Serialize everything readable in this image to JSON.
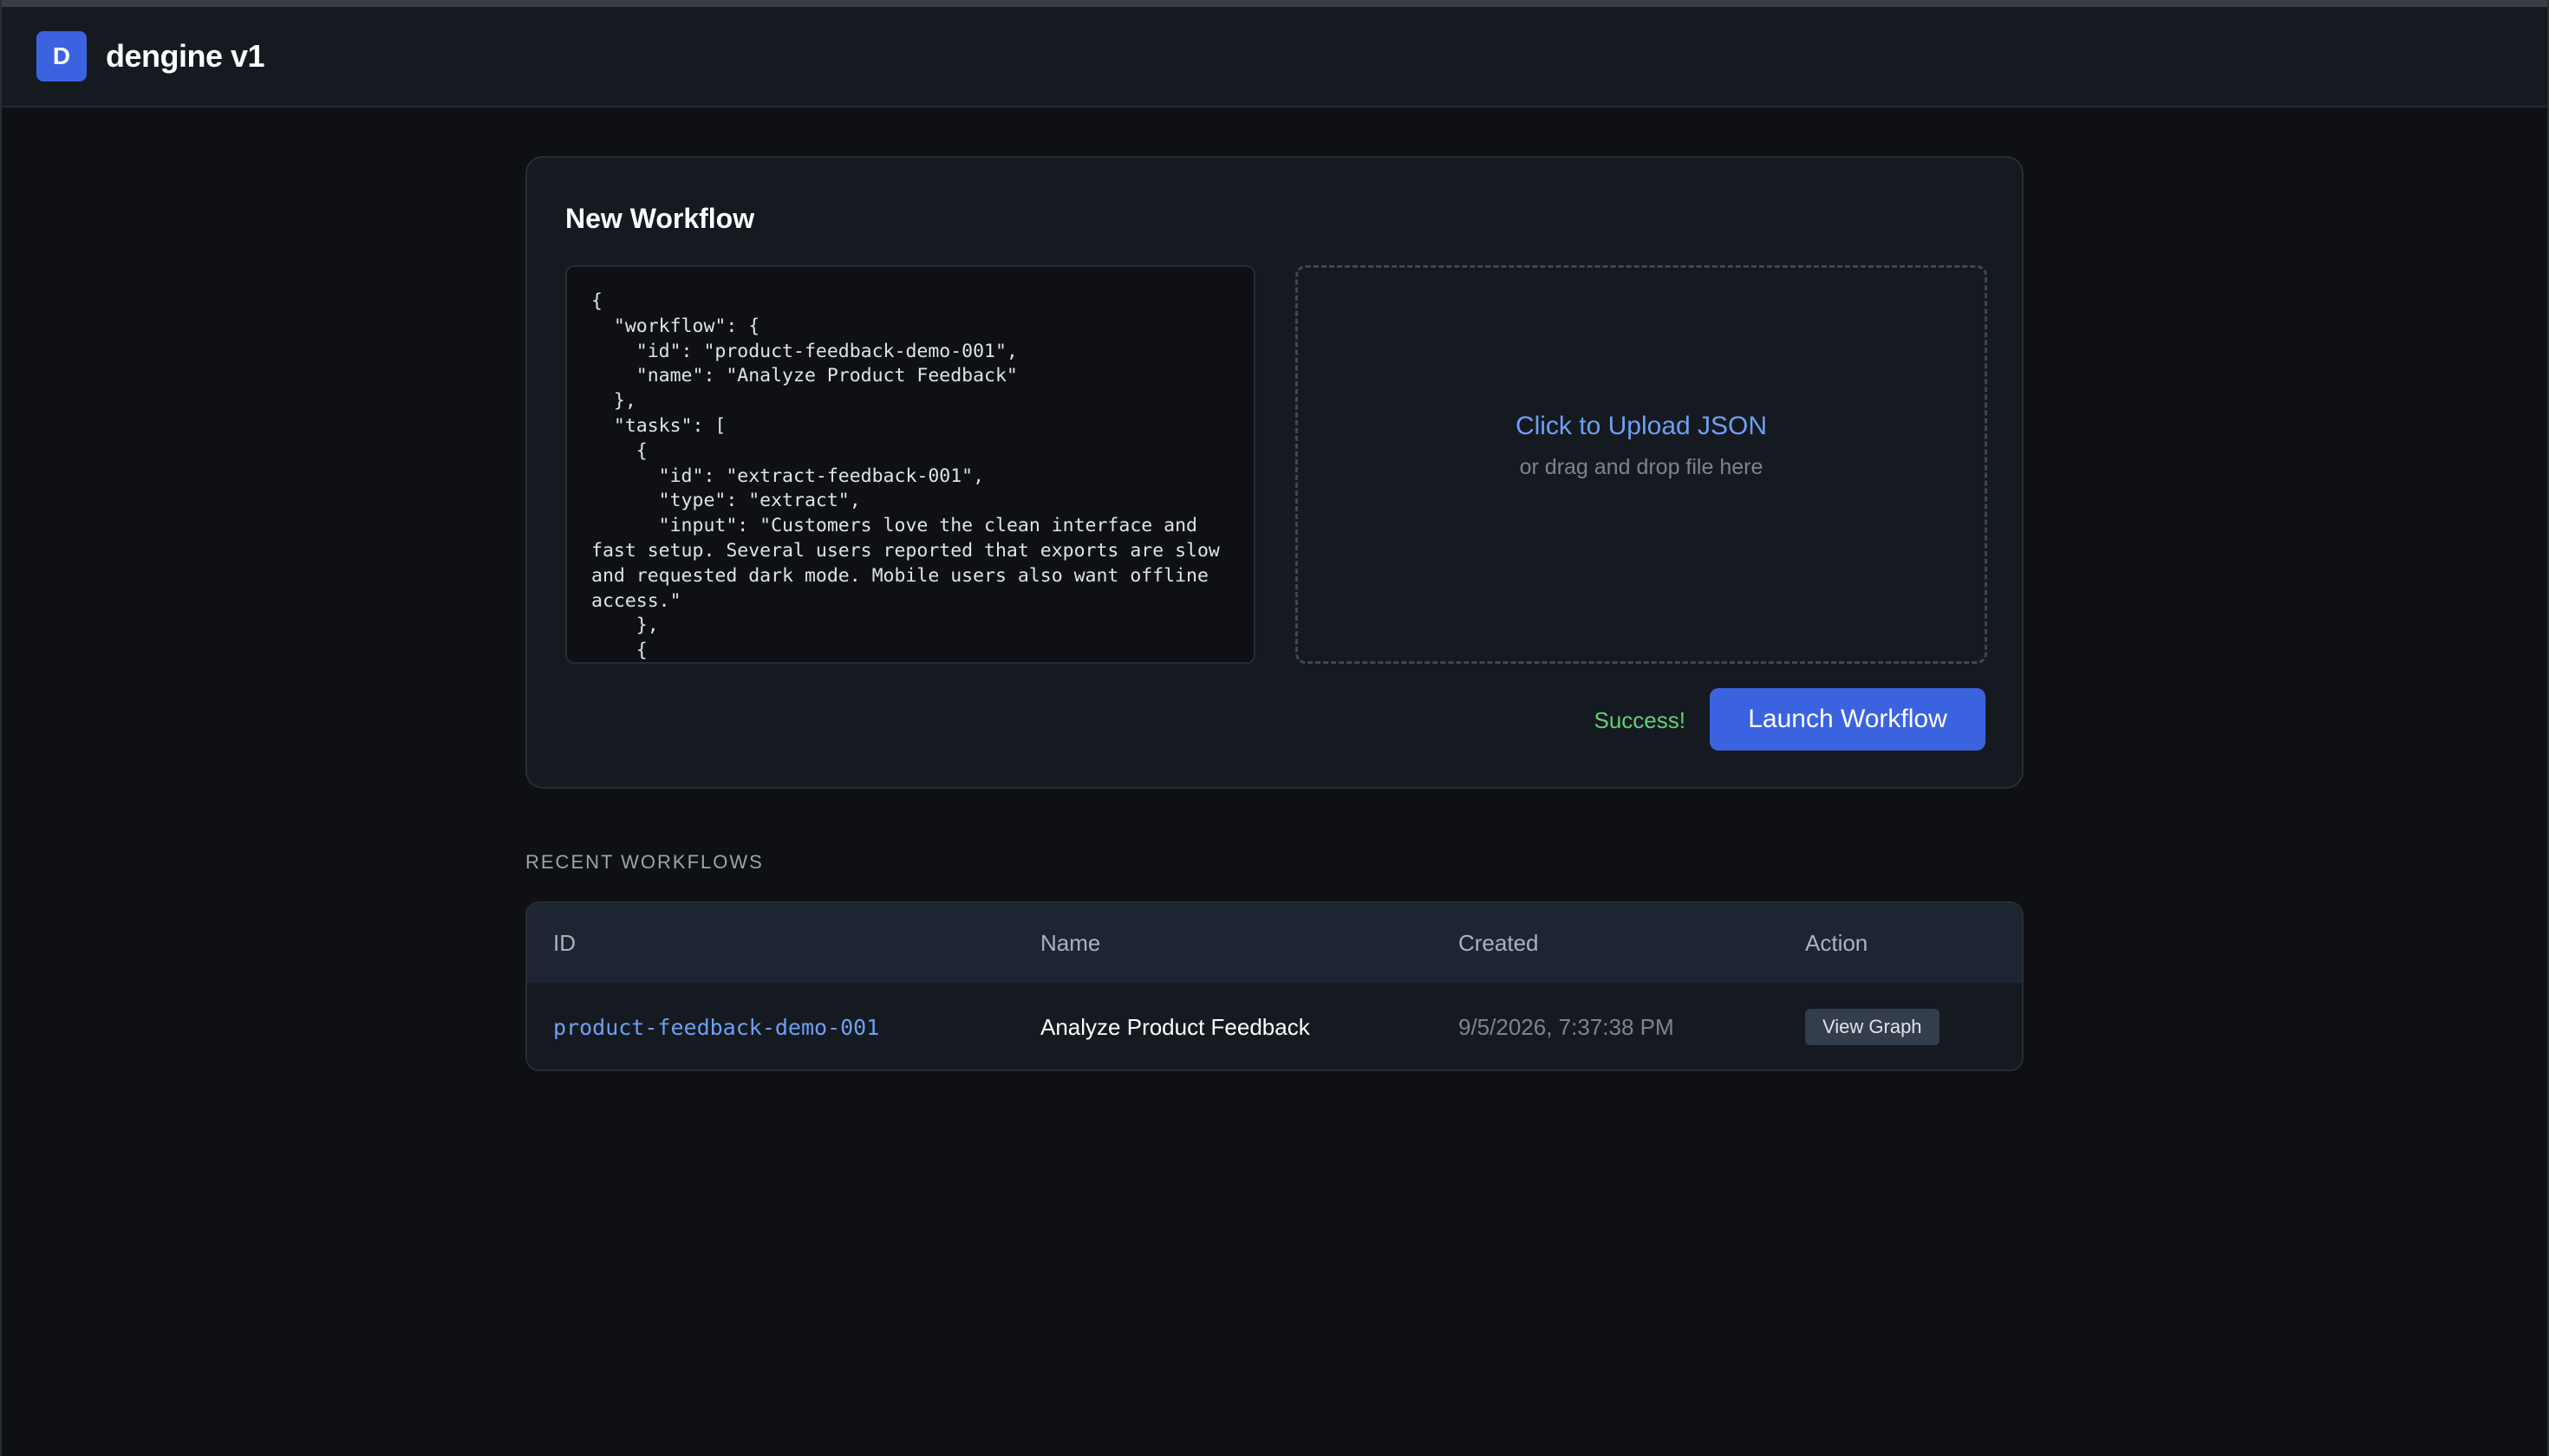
{
  "header": {
    "logo_letter": "D",
    "title": "dengine v1"
  },
  "new_workflow": {
    "title": "New Workflow",
    "editor_value": "{\n  \"workflow\": {\n    \"id\": \"product-feedback-demo-001\",\n    \"name\": \"Analyze Product Feedback\"\n  },\n  \"tasks\": [\n    {\n      \"id\": \"extract-feedback-001\",\n      \"type\": \"extract\",\n      \"input\": \"Customers love the clean interface and fast setup. Several users reported that exports are slow and requested dark mode. Mobile users also want offline access.\"\n    },\n    {",
    "upload": {
      "title": "Click to Upload JSON",
      "subtitle": "or drag and drop file here"
    },
    "status": "Success!",
    "launch_label": "Launch Workflow"
  },
  "recent": {
    "label": "RECENT WORKFLOWS",
    "columns": [
      "ID",
      "Name",
      "Created",
      "Action"
    ],
    "rows": [
      {
        "id": "product-feedback-demo-001",
        "name": "Analyze Product Feedback",
        "created": "9/5/2026, 7:37:38 PM",
        "action_label": "View Graph"
      }
    ]
  },
  "colors": {
    "accent": "#3b63e0",
    "link": "#6f9ff2",
    "success": "#62cf78",
    "background": "#0e1014",
    "panel": "#151a21"
  }
}
